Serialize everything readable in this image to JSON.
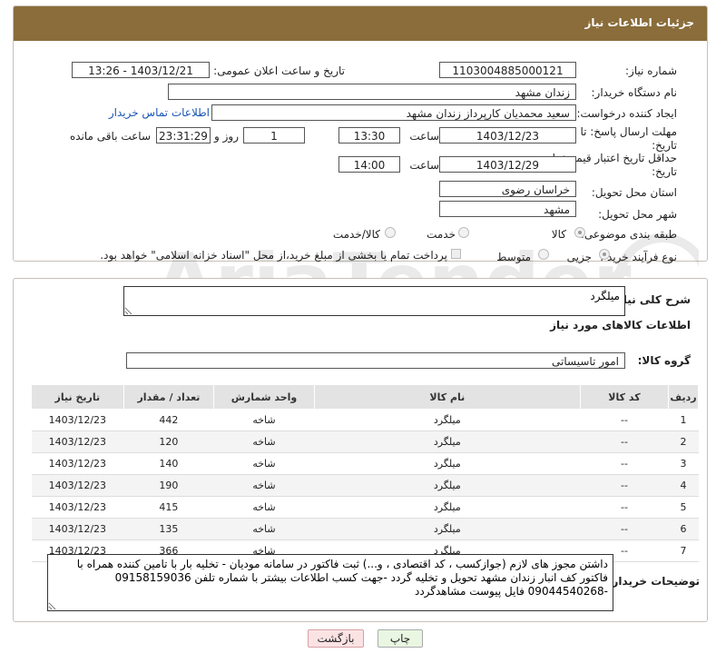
{
  "header": {
    "title": "جزئیات اطلاعات نیاز"
  },
  "labels": {
    "need_number": "شماره نیاز:",
    "announce_datetime": "تاریخ و ساعت اعلان عمومی:",
    "buyer_org": "نام دستگاه خریدار:",
    "requester": "ایجاد کننده درخواست:",
    "reply_deadline": "مهلت ارسال پاسخ: تا تاریخ:",
    "price_validity": "حداقل تاریخ اعتبار قیمت: تا تاریخ:",
    "hour": "ساعت",
    "day_and": "روز و",
    "remaining_hours": "ساعت باقی مانده",
    "delivery_province": "استان محل تحویل:",
    "delivery_city": "شهر محل تحویل:",
    "subject_class": "طبقه بندی موضوعی:",
    "purchase_process": "نوع فرآیند خرید :",
    "general_desc": "شرح کلی نیاز:",
    "goods_info": "اطلاعات کالاهای مورد نیاز",
    "goods_group": "گروه کالا:",
    "buyer_notes": "توضیحات خریدار:"
  },
  "fields": {
    "need_number": "1103004885000121",
    "announce_datetime": "1403/12/21 - 13:26",
    "buyer_org": "زندان مشهد",
    "requester": "سعید محمدیان کارپرداز زندان مشهد",
    "contact_link": "اطلاعات تماس خریدار",
    "reply_date": "1403/12/23",
    "reply_time": "13:30",
    "remaining_days": "1",
    "remaining_time": "23:31:29",
    "validity_date": "1403/12/29",
    "validity_time": "14:00",
    "province": "خراسان رضوی",
    "city": "مشهد",
    "general_desc": "میلگرد",
    "goods_group": "امور تاسیساتی",
    "buyer_notes": "داشتن مجوز های لازم (جوازکسب ، کد اقتصادی ، و...) ثبت فاکتور در سامانه مودیان - تخلیه بار با تامین کننده همراه با فاکتور کف انبار زندان مشهد تحویل و تخلیه گردد -جهت کسب اطلاعات بیشتر با شماره تلفن 09158159036  -09044540268 فایل پیوست مشاهدگردد"
  },
  "subject_options": {
    "goods": "کالا",
    "service": "خدمت",
    "goods_service": "کالا/خدمت",
    "selected": "goods"
  },
  "process_options": {
    "minor": "جزیی",
    "medium": "متوسط",
    "selected": "minor"
  },
  "payment_note": "پرداخت تمام یا بخشی از مبلغ خرید،از محل \"اسناد خزانه اسلامی\" خواهد بود.",
  "table": {
    "headers": [
      "ردیف",
      "کد کالا",
      "نام کالا",
      "واحد شمارش",
      "تعداد / مقدار",
      "تاریخ نیاز"
    ],
    "rows": [
      [
        "1",
        "--",
        "میلگرد",
        "شاخه",
        "442",
        "1403/12/23"
      ],
      [
        "2",
        "--",
        "میلگرد",
        "شاخه",
        "120",
        "1403/12/23"
      ],
      [
        "3",
        "--",
        "میلگرد",
        "شاخه",
        "140",
        "1403/12/23"
      ],
      [
        "4",
        "--",
        "میلگرد",
        "شاخه",
        "190",
        "1403/12/23"
      ],
      [
        "5",
        "--",
        "میلگرد",
        "شاخه",
        "415",
        "1403/12/23"
      ],
      [
        "6",
        "--",
        "میلگرد",
        "شاخه",
        "135",
        "1403/12/23"
      ],
      [
        "7",
        "--",
        "میلگرد",
        "شاخه",
        "366",
        "1403/12/23"
      ]
    ]
  },
  "buttons": {
    "print": "چاپ",
    "back": "بازگشت"
  },
  "colors": {
    "header_bg": "#8a6d3b",
    "back_button_bg": "#fbe3e4",
    "print_button_bg": "#e8f6e2"
  }
}
